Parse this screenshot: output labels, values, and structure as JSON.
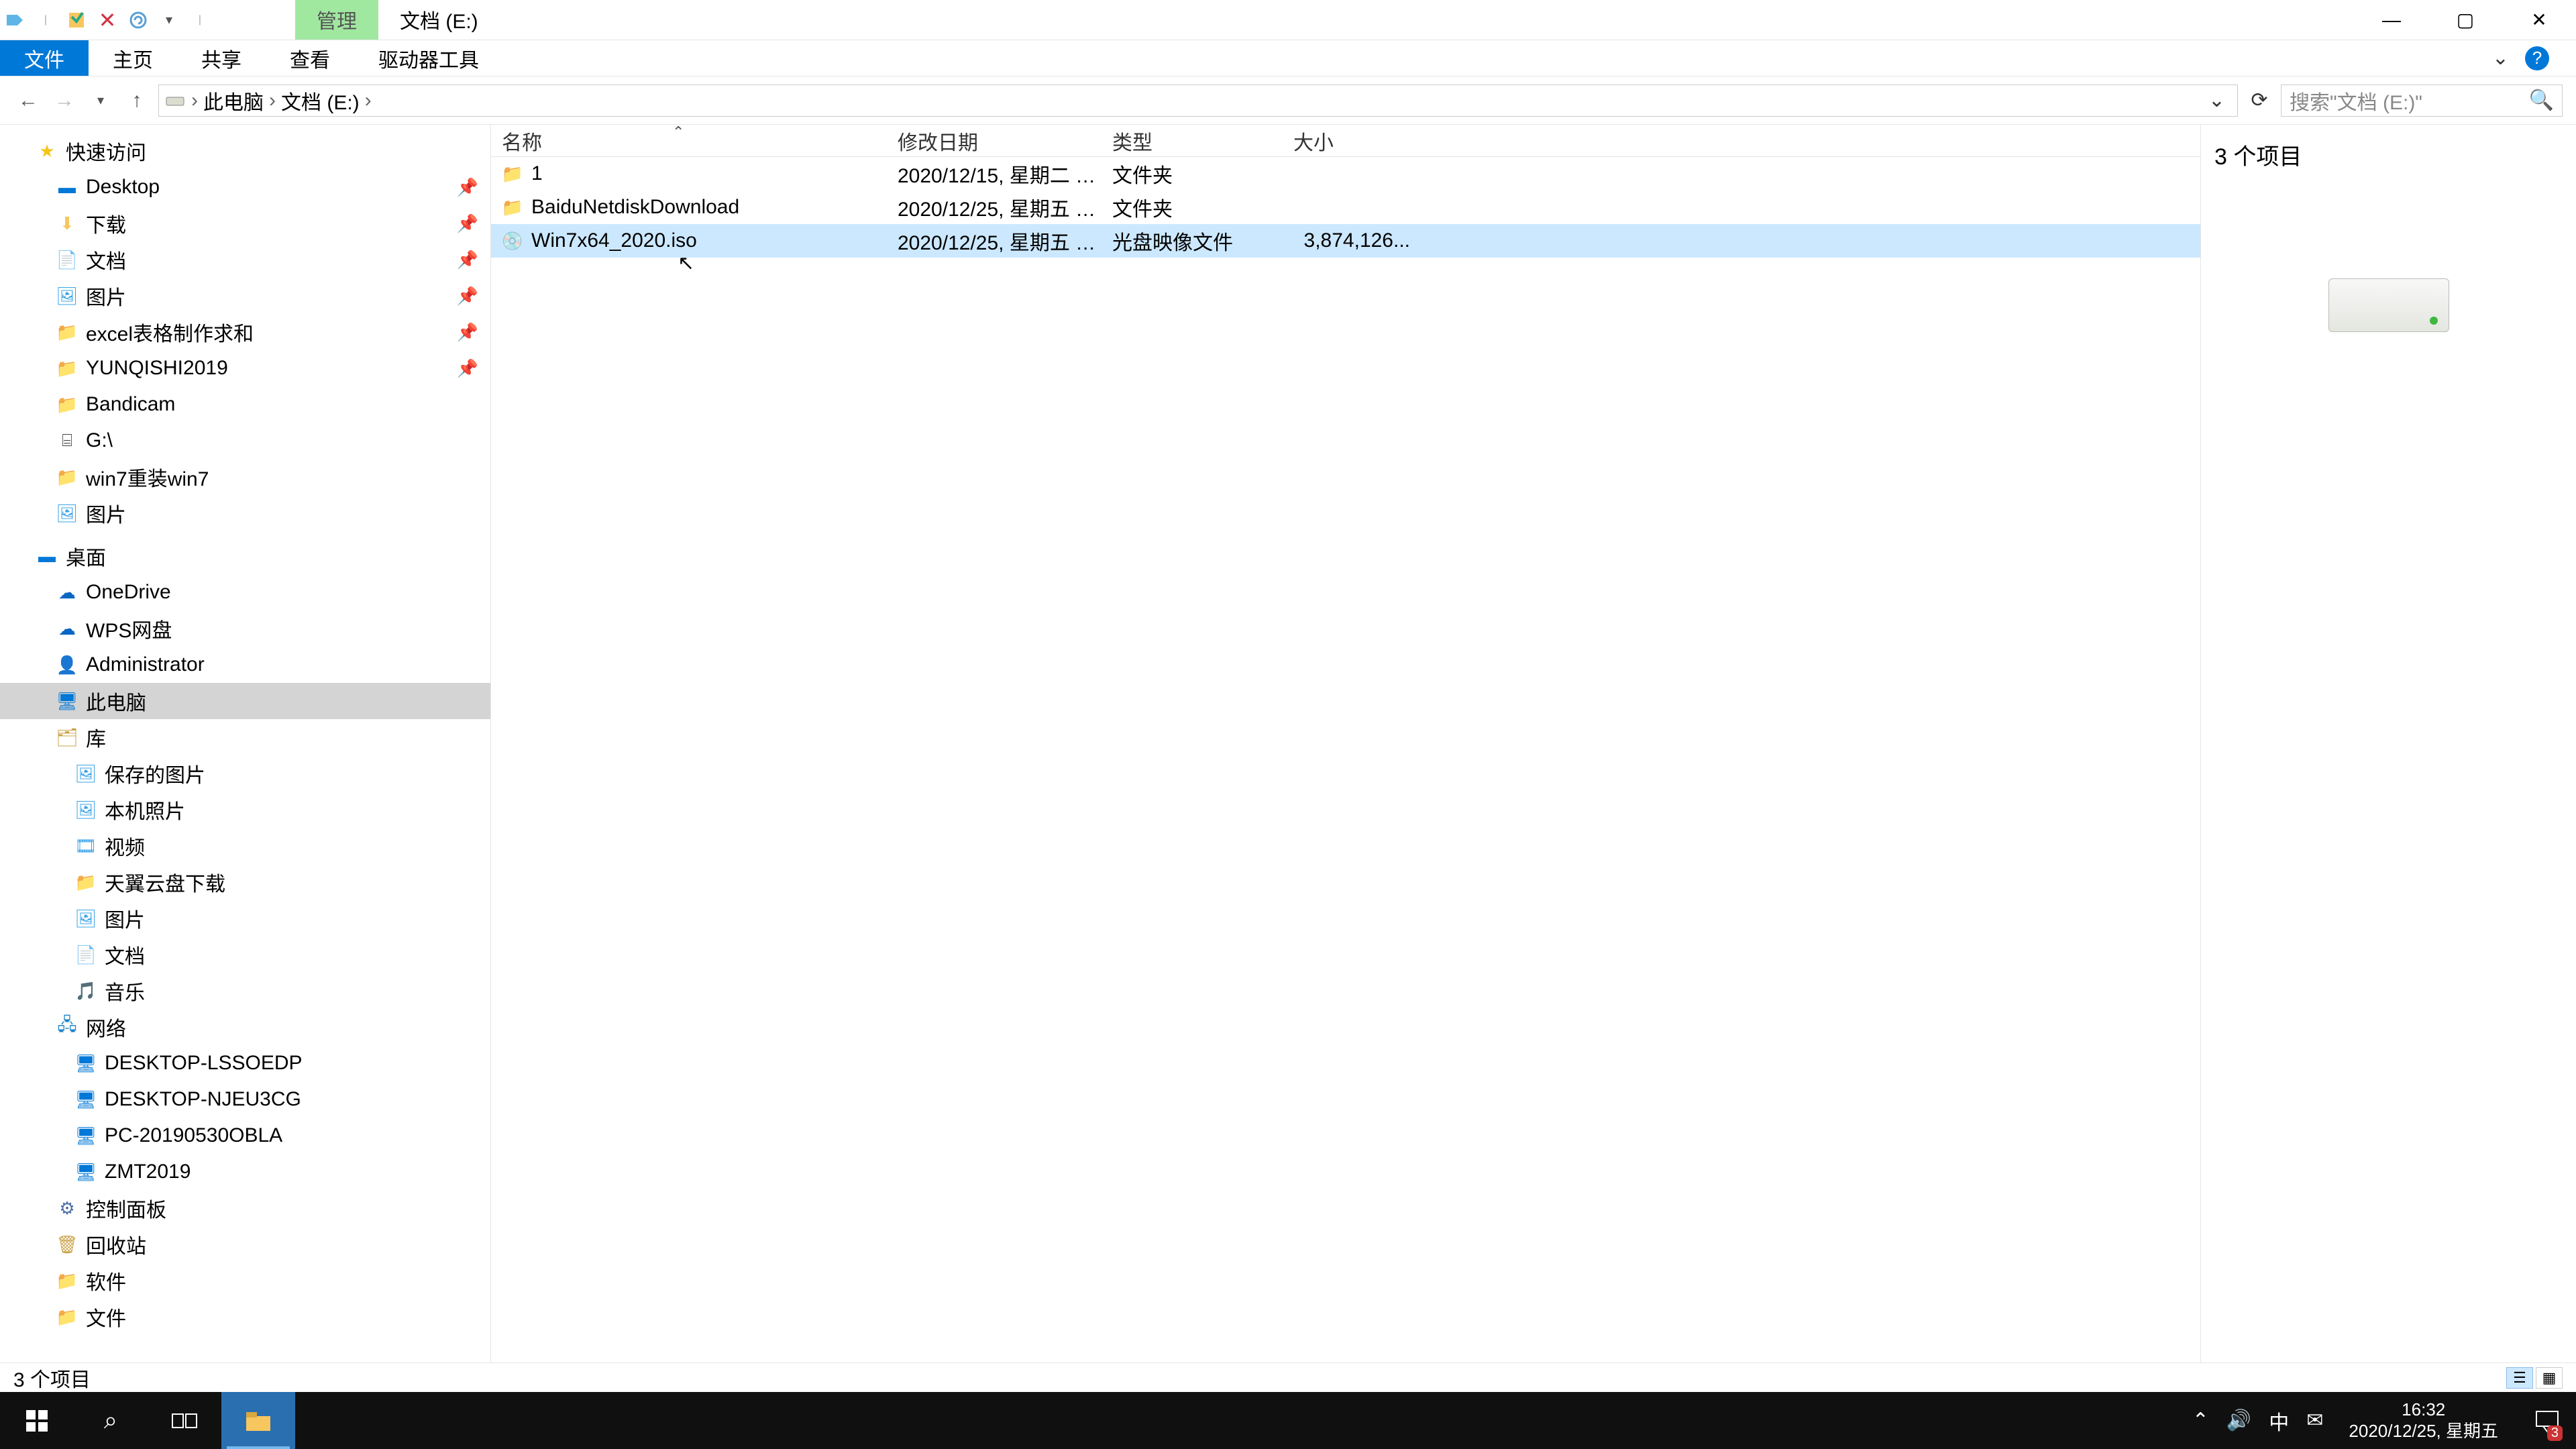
{
  "title_bar": {
    "contextual_tab": "管理",
    "location": "文档 (E:)"
  },
  "ribbon": {
    "file": "文件",
    "home": "主页",
    "share": "共享",
    "view": "查看",
    "drive_tools": "驱动器工具"
  },
  "breadcrumb": {
    "segs": [
      "此电脑",
      "文档 (E:)"
    ]
  },
  "search": {
    "placeholder": "搜索\"文档 (E:)\""
  },
  "nav": {
    "quick_access": "快速访问",
    "quick_items": [
      {
        "label": "Desktop",
        "icon": "desktop",
        "pin": true
      },
      {
        "label": "下载",
        "icon": "folder",
        "pin": true
      },
      {
        "label": "文档",
        "icon": "doc",
        "pin": true
      },
      {
        "label": "图片",
        "icon": "img",
        "pin": true
      },
      {
        "label": "excel表格制作求和",
        "icon": "folder",
        "pin": true
      },
      {
        "label": "YUNQISHI2019",
        "icon": "folder",
        "pin": true
      },
      {
        "label": "Bandicam",
        "icon": "folder",
        "pin": false
      },
      {
        "label": "G:\\",
        "icon": "drive",
        "pin": false
      },
      {
        "label": "win7重装win7",
        "icon": "folder",
        "pin": false
      },
      {
        "label": "图片",
        "icon": "img",
        "pin": false
      }
    ],
    "desktop_root": "桌面",
    "desktop_items": [
      {
        "label": "OneDrive",
        "icon": "onedrive"
      },
      {
        "label": "WPS网盘",
        "icon": "wps"
      },
      {
        "label": "Administrator",
        "icon": "user"
      },
      {
        "label": "此电脑",
        "icon": "pc",
        "selected": true
      },
      {
        "label": "库",
        "icon": "lib"
      }
    ],
    "lib_items": [
      {
        "label": "保存的图片",
        "icon": "img"
      },
      {
        "label": "本机照片",
        "icon": "img"
      },
      {
        "label": "视频",
        "icon": "img"
      },
      {
        "label": "天翼云盘下载",
        "icon": "img"
      },
      {
        "label": "图片",
        "icon": "img"
      },
      {
        "label": "文档",
        "icon": "doc"
      },
      {
        "label": "音乐",
        "icon": "img"
      }
    ],
    "network": "网络",
    "net_items": [
      {
        "label": "DESKTOP-LSSOEDP",
        "icon": "pc"
      },
      {
        "label": "DESKTOP-NJEU3CG",
        "icon": "pc"
      },
      {
        "label": "PC-20190530OBLA",
        "icon": "pc"
      },
      {
        "label": "ZMT2019",
        "icon": "pc"
      }
    ],
    "control_panel": "控制面板",
    "recycle": "回收站",
    "software": "软件",
    "documents": "文件"
  },
  "columns": {
    "name": "名称",
    "date": "修改日期",
    "type": "类型",
    "size": "大小"
  },
  "rows": [
    {
      "name": "1",
      "date": "2020/12/15, 星期二 1...",
      "type": "文件夹",
      "size": "",
      "icon": "folder",
      "selected": false
    },
    {
      "name": "BaiduNetdiskDownload",
      "date": "2020/12/25, 星期五 1...",
      "type": "文件夹",
      "size": "",
      "icon": "folder",
      "selected": false
    },
    {
      "name": "Win7x64_2020.iso",
      "date": "2020/12/25, 星期五 1...",
      "type": "光盘映像文件",
      "size": "3,874,126...",
      "icon": "disc",
      "selected": true
    }
  ],
  "preview": {
    "count_label": "3 个项目"
  },
  "status": {
    "text": "3 个项目"
  },
  "taskbar": {
    "time": "16:32",
    "date": "2020/12/25, 星期五",
    "ime": "中",
    "notif_badge": "3"
  }
}
